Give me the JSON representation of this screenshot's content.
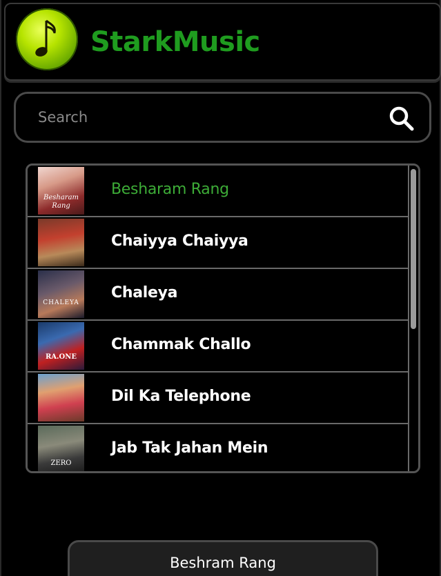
{
  "app": {
    "brand": "StarkMusic",
    "colors": {
      "brand_green": "#1f9c1f",
      "active_green": "#3dac37",
      "background": "#000000"
    }
  },
  "header": {
    "logo_icon": "music-note-icon"
  },
  "search": {
    "placeholder": "Search",
    "value": "",
    "icon": "search-icon"
  },
  "songs": [
    {
      "title": "Besharam Rang",
      "active": true,
      "thumb_text": "Besharam Rang"
    },
    {
      "title": "Chaiyya Chaiyya",
      "active": false,
      "thumb_text": ""
    },
    {
      "title": "Chaleya",
      "active": false,
      "thumb_text": "CHALEYA"
    },
    {
      "title": "Chammak Challo",
      "active": false,
      "thumb_text": "RA.ONE"
    },
    {
      "title": "Dil Ka Telephone",
      "active": false,
      "thumb_text": ""
    },
    {
      "title": "Jab Tak Jahan Mein",
      "active": false,
      "thumb_text": "ZERO"
    }
  ],
  "scroll": {
    "visible_fraction": 0.53
  },
  "now_playing": {
    "label": "Beshram Rang"
  }
}
